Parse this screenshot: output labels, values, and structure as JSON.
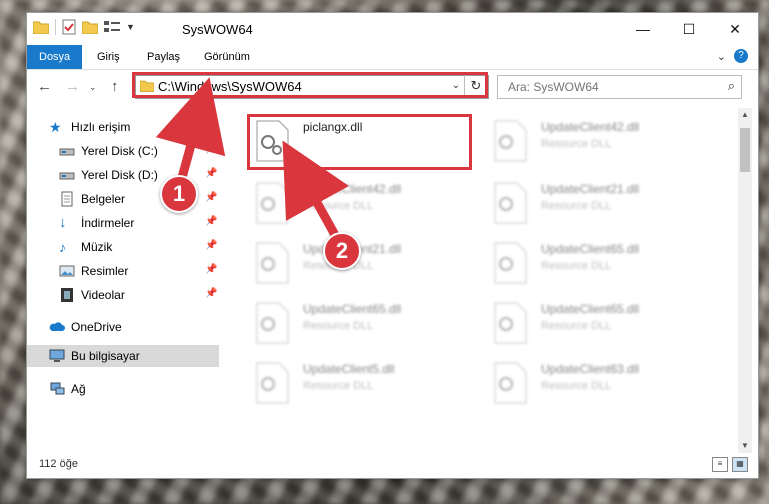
{
  "window": {
    "title": "SysWOW64",
    "controls": {
      "minimize": "—",
      "maximize": "☐",
      "close": "✕"
    }
  },
  "ribbon": {
    "tabs": [
      {
        "label": "Dosya",
        "active": true
      },
      {
        "label": "Giriş"
      },
      {
        "label": "Paylaş"
      },
      {
        "label": "Görünüm"
      }
    ],
    "help": "?"
  },
  "address": {
    "path": "C:\\Windows\\SysWOW64",
    "search_placeholder": "Ara: SysWOW64"
  },
  "sidebar": {
    "items": [
      {
        "label": "Hızlı erişim",
        "icon": "star-icon"
      },
      {
        "label": "Yerel Disk (C:)",
        "icon": "drive-icon",
        "pinned": true
      },
      {
        "label": "Yerel Disk (D:)",
        "icon": "drive-icon",
        "pinned": true
      },
      {
        "label": "Belgeler",
        "icon": "documents-icon",
        "pinned": true
      },
      {
        "label": "İndirmeler",
        "icon": "downloads-icon",
        "pinned": true
      },
      {
        "label": "Müzik",
        "icon": "music-icon",
        "pinned": true
      },
      {
        "label": "Resimler",
        "icon": "pictures-icon",
        "pinned": true
      },
      {
        "label": "Videolar",
        "icon": "videos-icon",
        "pinned": true
      },
      {
        "label": "OneDrive",
        "icon": "cloud-icon"
      },
      {
        "label": "Bu bilgisayar",
        "icon": "computer-icon",
        "selected": true
      },
      {
        "label": "Ağ",
        "icon": "network-icon"
      }
    ]
  },
  "files": [
    {
      "name": "piclangx.dll",
      "desc": "",
      "highlighted": true
    },
    {
      "name": "UpdateClient42.dll",
      "desc": "Resource DLL"
    },
    {
      "name": "UpdateClient42.dll",
      "desc": "Resource DLL"
    },
    {
      "name": "UpdateClient21.dll",
      "desc": "Resource DLL"
    },
    {
      "name": "UpdateClient21.dll",
      "desc": "Resource DLL"
    },
    {
      "name": "UpdateClient65.dll",
      "desc": "Resource DLL"
    },
    {
      "name": "UpdateClient65.dll",
      "desc": "Resource DLL"
    },
    {
      "name": "UpdateClient65.dll",
      "desc": "Resource DLL"
    },
    {
      "name": "UpdateClient5.dll",
      "desc": "Resource DLL"
    },
    {
      "name": "UpdateClient63.dll",
      "desc": "Resource DLL"
    }
  ],
  "status": {
    "count": "112 öğe"
  },
  "annotations": {
    "step1": "1",
    "step2": "2"
  },
  "colors": {
    "accent": "#1979ca",
    "highlight": "#d9363e"
  }
}
